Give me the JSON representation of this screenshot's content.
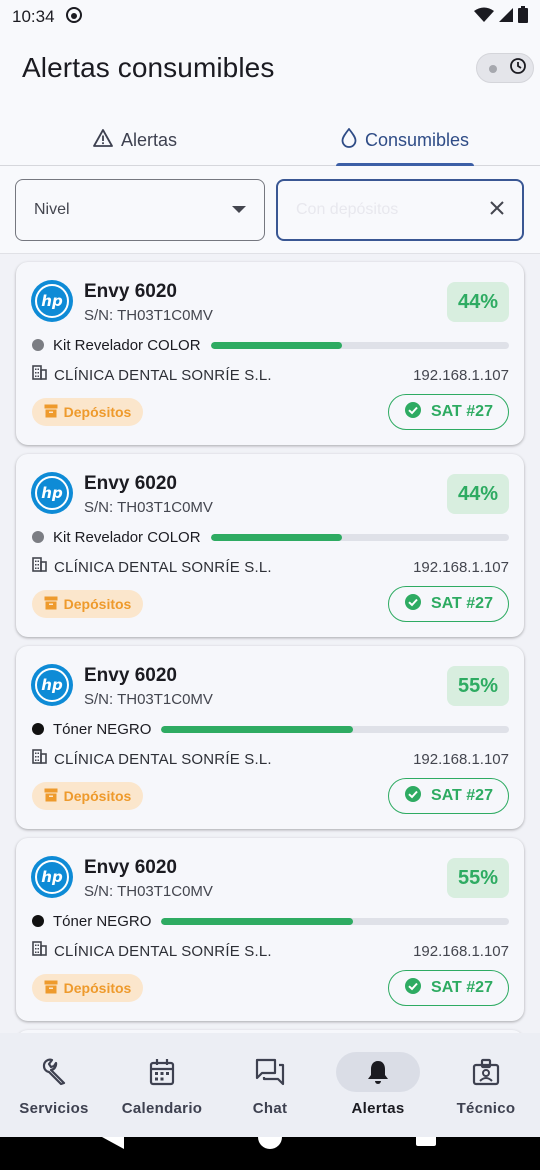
{
  "status_bar": {
    "time": "10:34"
  },
  "header": {
    "title": "Alertas consumibles"
  },
  "tabs": [
    {
      "label": "Alertas",
      "icon": "warning-icon",
      "active": false
    },
    {
      "label": "Consumibles",
      "icon": "water-drop-icon",
      "active": true
    }
  ],
  "filters": {
    "nivel_label": "Nivel",
    "search_placeholder": "Con depósitos"
  },
  "cards": [
    {
      "brand": "hp",
      "model": "Envy 6020",
      "serial": "S/N: TH03T1C0MV",
      "percent_label": "44%",
      "level": 0.44,
      "consumable": "Kit Revelador COLOR",
      "dot_color": "#7b7d83",
      "client": "CLÍNICA DENTAL SONRÍE S.L.",
      "ip": "192.168.1.107",
      "deposit_label": "Depósitos",
      "sat_label": "SAT #27"
    },
    {
      "brand": "hp",
      "model": "Envy 6020",
      "serial": "S/N: TH03T1C0MV",
      "percent_label": "44%",
      "level": 0.44,
      "consumable": "Kit Revelador COLOR",
      "dot_color": "#7b7d83",
      "client": "CLÍNICA DENTAL SONRÍE S.L.",
      "ip": "192.168.1.107",
      "deposit_label": "Depósitos",
      "sat_label": "SAT #27"
    },
    {
      "brand": "hp",
      "model": "Envy 6020",
      "serial": "S/N: TH03T1C0MV",
      "percent_label": "55%",
      "level": 0.55,
      "consumable": "Tóner NEGRO",
      "dot_color": "#111111",
      "client": "CLÍNICA DENTAL SONRÍE S.L.",
      "ip": "192.168.1.107",
      "deposit_label": "Depósitos",
      "sat_label": "SAT #27"
    },
    {
      "brand": "hp",
      "model": "Envy 6020",
      "serial": "S/N: TH03T1C0MV",
      "percent_label": "55%",
      "level": 0.55,
      "consumable": "Tóner NEGRO",
      "dot_color": "#111111",
      "client": "CLÍNICA DENTAL SONRÍE S.L.",
      "ip": "192.168.1.107",
      "deposit_label": "Depósitos",
      "sat_label": "SAT #27"
    }
  ],
  "bottom_nav": [
    {
      "label": "Servicios",
      "icon": "wrench-icon",
      "active": false
    },
    {
      "label": "Calendario",
      "icon": "calendar-icon",
      "active": false
    },
    {
      "label": "Chat",
      "icon": "chat-icon",
      "active": false
    },
    {
      "label": "Alertas",
      "icon": "bell-icon",
      "active": true
    },
    {
      "label": "Técnico",
      "icon": "technician-badge-icon",
      "active": false
    }
  ],
  "colors": {
    "accent": "#3c5fa6",
    "success": "#2eab62",
    "warning": "#ee9a2c",
    "hp_blue": "#0e8bd6"
  }
}
